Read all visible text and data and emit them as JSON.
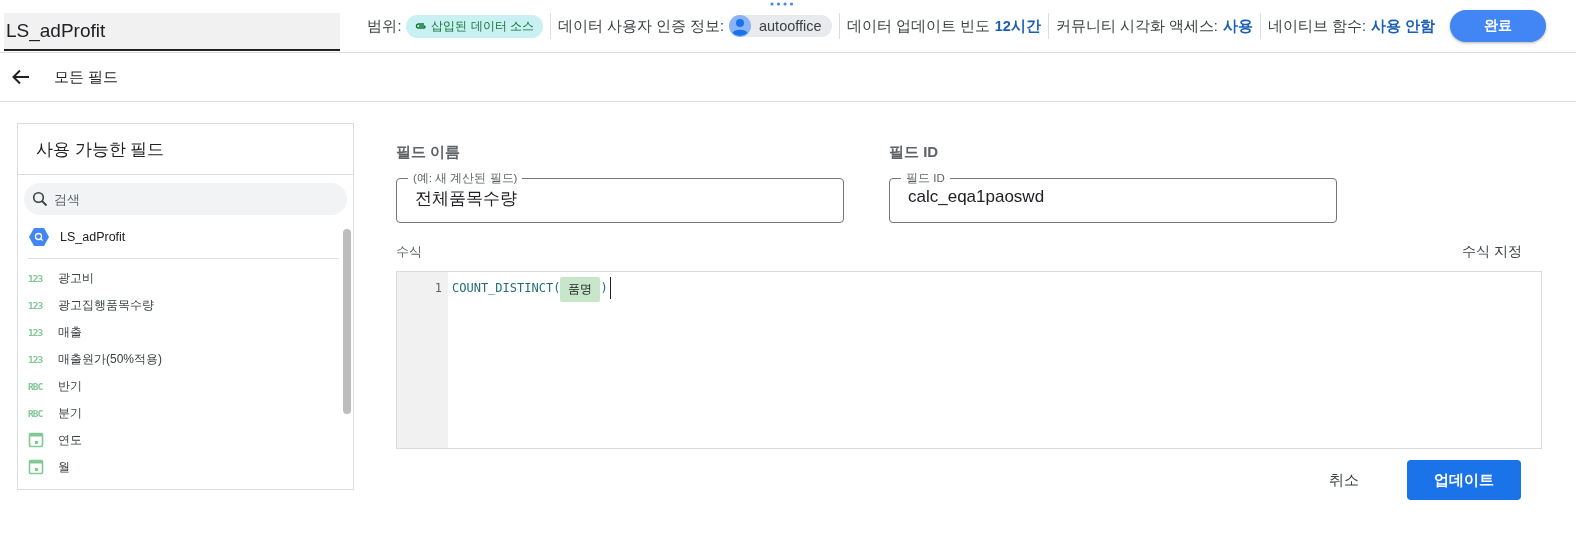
{
  "header": {
    "source_name": "LS_adProfit",
    "scope_label": "범위:",
    "scope_chip": "삽입된 데이터 소스",
    "credentials_label": "데이터 사용자 인증 정보:",
    "credentials_user": "autooffice",
    "freshness_label": "데이터 업데이트 빈도",
    "freshness_value": "12시간",
    "community_label": "커뮤니티 시각화 액세스:",
    "community_value": "사용",
    "native_label": "네이티브 함수:",
    "native_value": "사용 안함",
    "done_button": "완료"
  },
  "nav": {
    "title": "모든 필드"
  },
  "sidebar": {
    "title": "사용 가능한 필드",
    "search_placeholder": "검색",
    "source": "LS_adProfit",
    "fields": [
      {
        "kind": "number",
        "badge": "123",
        "label": "광고비"
      },
      {
        "kind": "number",
        "badge": "123",
        "label": "광고집행품목수량"
      },
      {
        "kind": "number",
        "badge": "123",
        "label": "매출"
      },
      {
        "kind": "number",
        "badge": "123",
        "label": "매출원가(50%적용)"
      },
      {
        "kind": "text",
        "badge": "RBC",
        "label": "반기"
      },
      {
        "kind": "text",
        "badge": "RBC",
        "label": "분기"
      },
      {
        "kind": "date",
        "label": "연도"
      },
      {
        "kind": "date",
        "label": "월"
      }
    ]
  },
  "editor": {
    "name_heading": "필드 이름",
    "name_floating_label": "(예: 새 계산된 필드)",
    "name_value": "전체품목수량",
    "id_heading": "필드 ID",
    "id_floating_label": "필드 ID",
    "id_value": "calc_eqa1paoswd",
    "formula_label": "수식",
    "format_link": "수식 지정",
    "formula": {
      "line_number": "1",
      "prefix": "COUNT_DISTINCT(",
      "field_chip": "품명",
      "suffix": ")"
    },
    "cancel_button": "취소",
    "update_button": "업데이트"
  }
}
